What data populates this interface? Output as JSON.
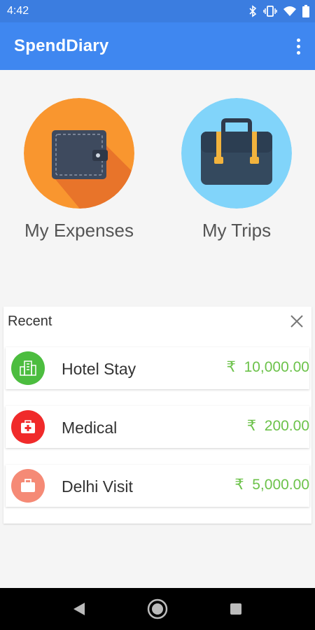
{
  "status_bar": {
    "time": "4:42",
    "icons": [
      "bluetooth-icon",
      "vibrate-icon",
      "wifi-icon",
      "battery-icon"
    ]
  },
  "app_bar": {
    "title": "SpendDiary",
    "menu_icon": "more-vertical-icon",
    "color": "#3f87f0"
  },
  "tiles": [
    {
      "label": "My Expenses",
      "icon": "wallet-icon",
      "color": "#f9962f"
    },
    {
      "label": "My Trips",
      "icon": "briefcase-icon",
      "color": "#81d4fa"
    }
  ],
  "recent": {
    "title": "Recent",
    "close_icon": "close-icon",
    "items": [
      {
        "name": "Hotel Stay",
        "currency": "₹",
        "amount": "10,000.00",
        "icon": "hotel-icon",
        "color": "#4cbd3f"
      },
      {
        "name": "Medical",
        "currency": "₹",
        "amount": "200.00",
        "icon": "medical-kit-icon",
        "color": "#f02a2a"
      },
      {
        "name": "Delhi Visit",
        "currency": "₹",
        "amount": "5,000.00",
        "icon": "suitcase-icon",
        "color": "#f58a76"
      }
    ]
  },
  "nav_bar": {
    "buttons": [
      "back-icon",
      "home-icon",
      "recents-icon"
    ]
  }
}
